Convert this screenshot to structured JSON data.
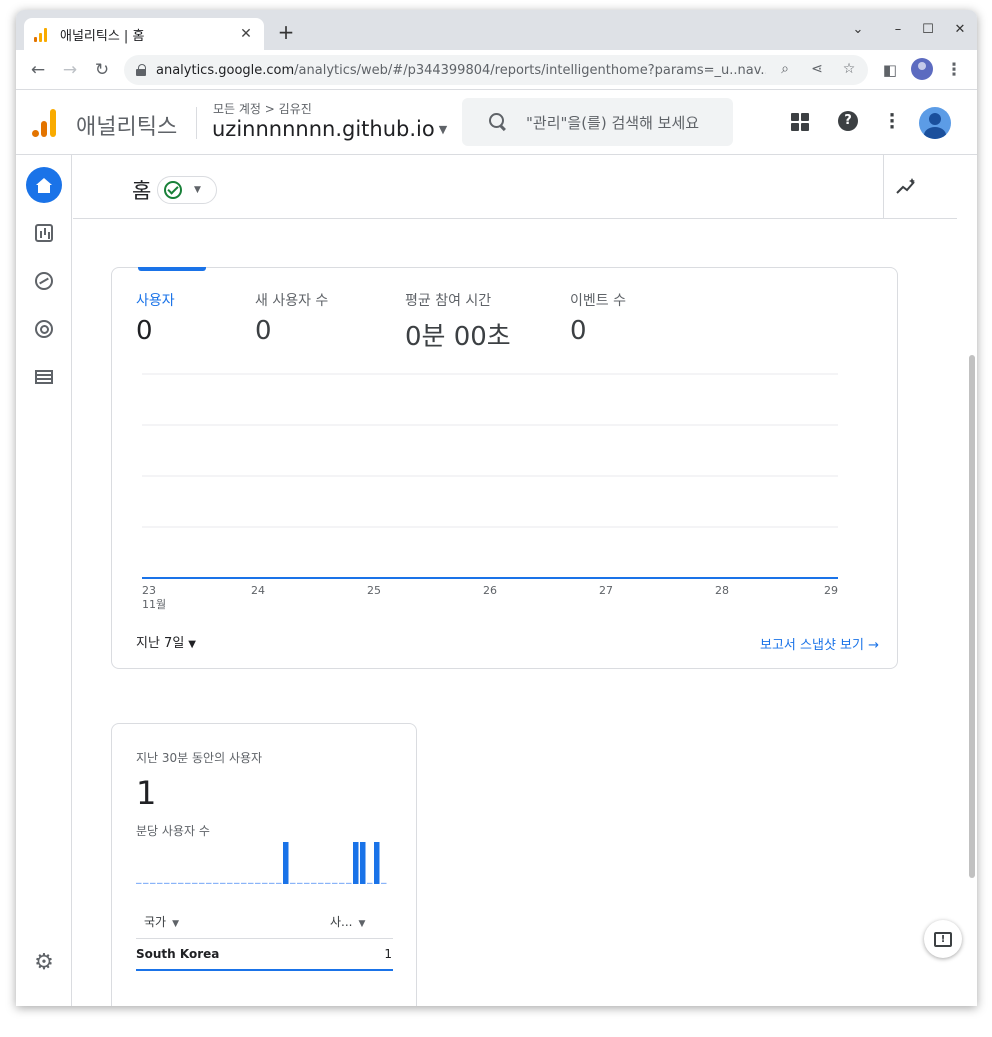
{
  "browser": {
    "tab_title": "애널리틱스 | 홈",
    "tab_close": "✕",
    "new_tab": "+",
    "url_host": "analytics.google.com",
    "url_path": "/analytics/web/#/p344399804/reports/intelligenthome?params=_u..nav...",
    "window_controls": [
      "⌄",
      "–",
      "☐",
      "✕"
    ]
  },
  "header": {
    "app_name": "애널리틱스",
    "breadcrumb": "모든 계정 > 김유진",
    "property": "uzinnnnnnn.github.io",
    "search_placeholder": "\"관리\"을(를) 검색해 보세요"
  },
  "page": {
    "title": "홈"
  },
  "overview_card": {
    "metrics": [
      {
        "label": "사용자",
        "value": "0"
      },
      {
        "label": "새 사용자 수",
        "value": "0"
      },
      {
        "label": "평균 참여 시간",
        "value": "0분 00초"
      },
      {
        "label": "이벤트 수",
        "value": "0"
      }
    ],
    "date_range": "지난 7일",
    "snapshot_link": "보고서 스냅샷 보기 →"
  },
  "chart_data": {
    "type": "line",
    "x": [
      "23",
      "24",
      "25",
      "26",
      "27",
      "28",
      "29"
    ],
    "x_sublabel": "11월",
    "series": [
      {
        "values": [
          0,
          0,
          0,
          0,
          0,
          0,
          0
        ]
      }
    ],
    "grid": true,
    "color": "#1a73e8"
  },
  "realtime_card": {
    "title": "지난 30분 동안의 사용자",
    "value": "1",
    "subtitle": "분당 사용자 수",
    "per_minute": [
      0,
      0,
      0,
      0,
      0,
      0,
      0,
      0,
      0,
      0,
      0,
      0,
      0,
      0,
      0,
      0,
      0,
      0,
      0,
      0,
      0,
      1,
      0,
      0,
      0,
      0,
      0,
      0,
      0,
      0,
      0,
      1,
      1,
      0,
      1,
      0
    ],
    "col_country": "국가",
    "col_users": "사...",
    "rows": [
      {
        "country": "South Korea",
        "users": "1"
      }
    ]
  },
  "icons": {
    "gear": "⚙",
    "feedback": "!"
  }
}
